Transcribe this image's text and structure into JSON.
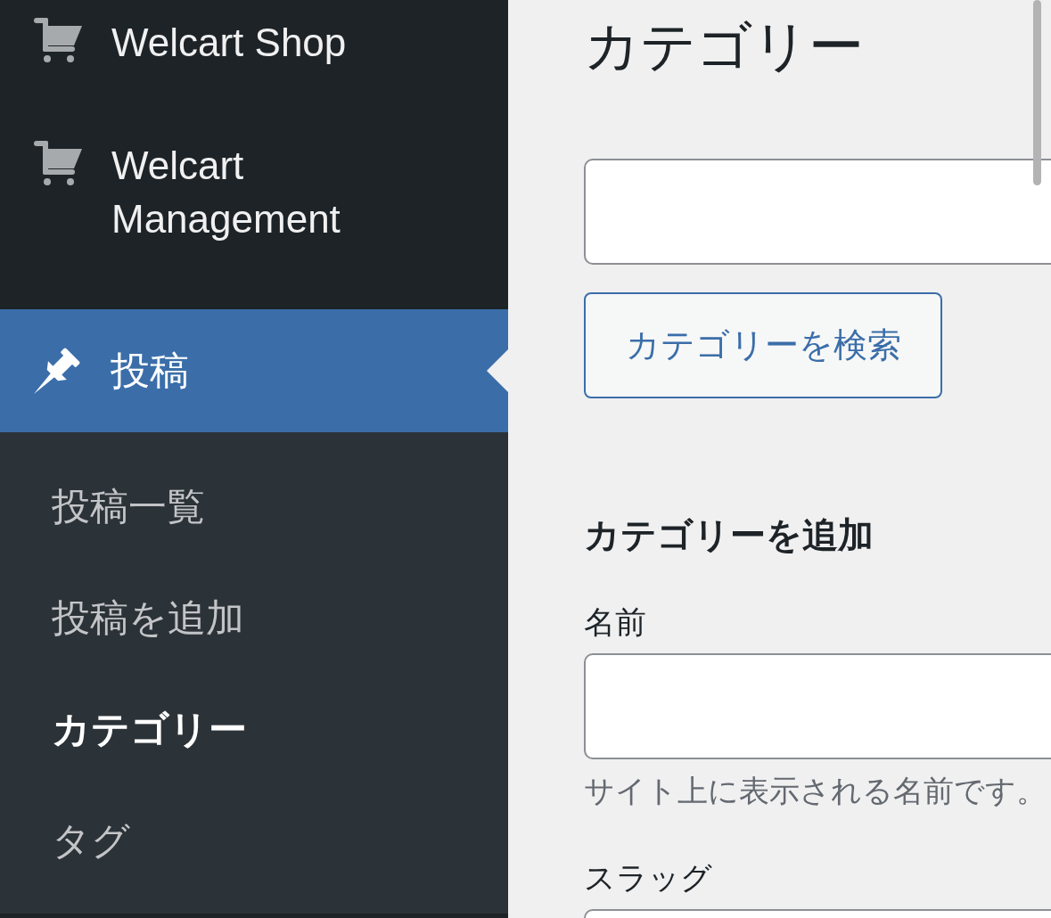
{
  "sidebar": {
    "menu": [
      {
        "label": "Welcart Shop",
        "kind": "cart",
        "selected": false
      },
      {
        "label": "Welcart Management",
        "kind": "cart",
        "selected": false
      },
      {
        "label": "投稿",
        "kind": "pin",
        "selected": true,
        "children": [
          {
            "label": "投稿一覧",
            "selected": false
          },
          {
            "label": "投稿を追加",
            "selected": false
          },
          {
            "label": "カテゴリー",
            "selected": true
          },
          {
            "label": "タグ",
            "selected": false
          }
        ]
      }
    ]
  },
  "main": {
    "title": "カテゴリー",
    "search": {
      "button": "カテゴリーを検索"
    },
    "add_form": {
      "heading": "カテゴリーを追加",
      "fields": [
        {
          "label": "名前",
          "hint": "サイト上に表示される名前です。"
        },
        {
          "label": "スラッグ"
        }
      ]
    }
  }
}
